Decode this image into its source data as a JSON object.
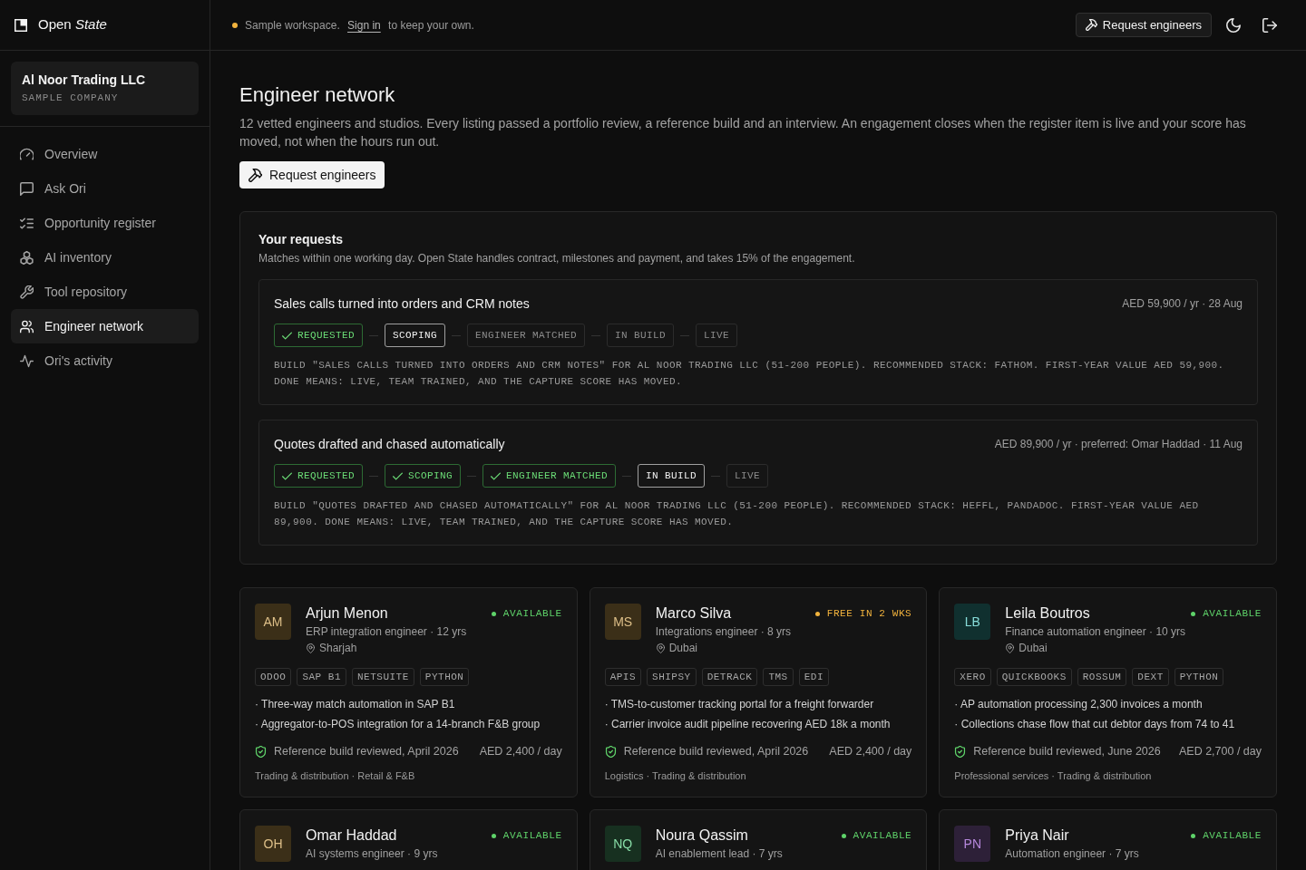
{
  "sidebar": {
    "brand": "Open *State*",
    "company": {
      "name": "Al Noor Trading LLC",
      "tag": "SAMPLE COMPANY"
    },
    "nav": [
      {
        "label": "Overview",
        "selected": false
      },
      {
        "label": "Ask Ori",
        "selected": false
      },
      {
        "label": "Opportunity register",
        "selected": false
      },
      {
        "label": "AI inventory",
        "selected": false
      },
      {
        "label": "Tool repository",
        "selected": false
      },
      {
        "label": "Engineer network",
        "selected": true
      },
      {
        "label": "Ori's activity",
        "selected": false
      }
    ]
  },
  "topbar": {
    "notice": {
      "before": "Sample workspace.",
      "link": "Sign in",
      "after": "to keep your own."
    },
    "button": "Request engineers"
  },
  "page": {
    "title": "Engineer network",
    "description": "12 vetted engineers and studios. Every listing passed a portfolio review, a reference build and an interview. An engagement closes when the register item is live and your score has moved, not when the hours run out.",
    "button": "Request engineers"
  },
  "requests": {
    "title": "Your requests",
    "subtitle": "Matches within one working day. Open State handles contract, milestones and payment, and takes 15% of the engagement.",
    "items": [
      {
        "title": "Sales calls turned into orders and CRM notes",
        "meta": "AED 59,900 / yr · 28 Aug",
        "steps": [
          {
            "label": "REQUESTED",
            "kind": "done"
          },
          {
            "label": "SCOPING",
            "kind": "current"
          },
          {
            "label": "ENGINEER MATCHED",
            "kind": "pending"
          },
          {
            "label": "IN BUILD",
            "kind": "pending"
          },
          {
            "label": "LIVE",
            "kind": "pending"
          }
        ],
        "description": "BUILD \"SALES CALLS TURNED INTO ORDERS AND CRM NOTES\" FOR AL NOOR TRADING LLC (51-200 PEOPLE). RECOMMENDED STACK: FATHOM. FIRST-YEAR VALUE AED 59,900. DONE MEANS: LIVE, TEAM TRAINED, AND THE CAPTURE SCORE HAS MOVED."
      },
      {
        "title": "Quotes drafted and chased automatically",
        "meta": "AED 89,900 / yr · preferred: Omar Haddad · 11 Aug",
        "steps": [
          {
            "label": "REQUESTED",
            "kind": "done"
          },
          {
            "label": "SCOPING",
            "kind": "done"
          },
          {
            "label": "ENGINEER MATCHED",
            "kind": "done"
          },
          {
            "label": "IN BUILD",
            "kind": "current"
          },
          {
            "label": "LIVE",
            "kind": "pending"
          }
        ],
        "description": "BUILD \"QUOTES DRAFTED AND CHASED AUTOMATICALLY\" FOR AL NOOR TRADING LLC (51-200 PEOPLE). RECOMMENDED STACK: HEFFL, PANDADOC. FIRST-YEAR VALUE AED 89,900. DONE MEANS: LIVE, TEAM TRAINED, AND THE CAPTURE SCORE HAS MOVED."
      }
    ]
  },
  "engineers": [
    {
      "initials": "AM",
      "color": "#3b2f18",
      "name": "Arjun Menon",
      "role": "ERP integration engineer · 12 yrs",
      "location": "Sharjah",
      "status": {
        "label": "AVAILABLE",
        "color": "#5fd36a"
      },
      "tags": [
        "ODOO",
        "SAP B1",
        "NETSUITE",
        "PYTHON"
      ],
      "highlights": [
        "· Three-way match automation in SAP B1",
        "· Aggregator-to-POS integration for a 14-branch F&B group"
      ],
      "review": "Reference build reviewed, April 2026",
      "rate": "AED 2,400 / day",
      "sectors": "Trading & distribution · Retail & F&B"
    },
    {
      "initials": "MS",
      "color": "#3b2f18",
      "name": "Marco Silva",
      "role": "Integrations engineer · 8 yrs",
      "location": "Dubai",
      "status": {
        "label": "FREE IN 2 WKS",
        "color": "#f2b33d"
      },
      "tags": [
        "APIS",
        "SHIPSY",
        "DETRACK",
        "TMS",
        "EDI"
      ],
      "highlights": [
        "· TMS-to-customer tracking portal for a freight forwarder",
        "· Carrier invoice audit pipeline recovering AED 18k a month"
      ],
      "review": "Reference build reviewed, April 2026",
      "rate": "AED 2,400 / day",
      "sectors": "Logistics · Trading & distribution"
    },
    {
      "initials": "LB",
      "color": "#10302f",
      "name": "Leila Boutros",
      "role": "Finance automation engineer · 10 yrs",
      "location": "Dubai",
      "status": {
        "label": "AVAILABLE",
        "color": "#5fd36a"
      },
      "tags": [
        "XERO",
        "QUICKBOOKS",
        "ROSSUM",
        "DEXT",
        "PYTHON"
      ],
      "highlights": [
        "· AP automation processing 2,300 invoices a month",
        "· Collections chase flow that cut debtor days from 74 to 41"
      ],
      "review": "Reference build reviewed, June 2026",
      "rate": "AED 2,700 / day",
      "sectors": "Professional services · Trading & distribution"
    },
    {
      "initials": "OH",
      "color": "#3b2f18",
      "name": "Omar Haddad",
      "role": "AI systems engineer · 9 yrs",
      "status": {
        "label": "AVAILABLE",
        "color": "#5fd36a"
      }
    },
    {
      "initials": "NQ",
      "color": "#173020",
      "name": "Noura Qassim",
      "role": "AI enablement lead · 7 yrs",
      "status": {
        "label": "AVAILABLE",
        "color": "#5fd36a"
      }
    },
    {
      "initials": "PN",
      "color": "#2d2038",
      "name": "Priya Nair",
      "role": "Automation engineer · 7 yrs",
      "status": {
        "label": "AVAILABLE",
        "color": "#5fd36a"
      }
    }
  ]
}
